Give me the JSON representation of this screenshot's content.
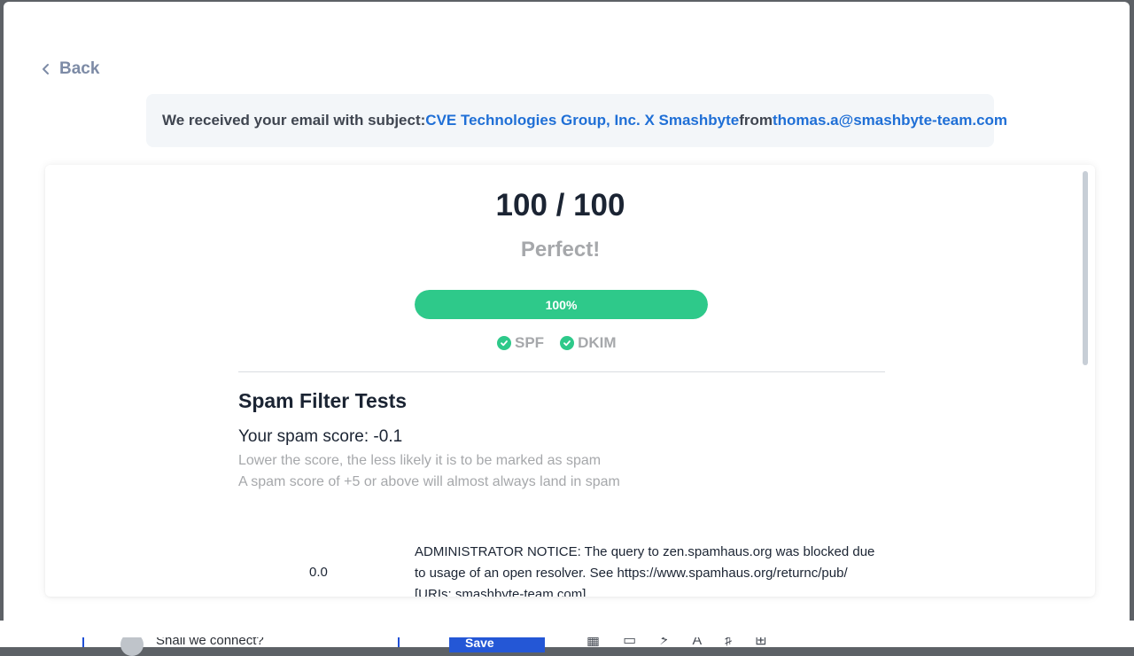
{
  "back_label": "Back",
  "banner": {
    "prefix": "We received your email with subject:",
    "subject": "CVE Technologies Group, Inc. X Smashbyte",
    "from_label": "from",
    "sender": "thomas.a@smashbyte-team.com"
  },
  "result": {
    "score_text": "100 / 100",
    "verdict": "Perfect!",
    "progress_label": "100%",
    "progress_value": 1.0,
    "checks": [
      {
        "label": "SPF",
        "status": "pass"
      },
      {
        "label": "DKIM",
        "status": "pass"
      }
    ]
  },
  "spam_tests": {
    "title": "Spam Filter Tests",
    "score_line": "Your spam score: -0.1",
    "hint_1": "Lower the score, the less likely it is to be marked as spam",
    "hint_2": "A spam score of +5 or above will almost always land in spam",
    "rows": [
      {
        "score": "0.0",
        "description": "ADMINISTRATOR NOTICE: The query to zen.spamhaus.org was blocked due to usage of an open resolver. See https://www.spamhaus.org/returnc/pub/ [URIs: smashbyte-team.com]"
      }
    ]
  },
  "underlay": {
    "subject_line": "Shall we connect?",
    "save_label": "Save"
  },
  "colors": {
    "accent_green": "#2ec98a",
    "link_blue": "#1f6fd6",
    "save_blue": "#2457d6"
  }
}
